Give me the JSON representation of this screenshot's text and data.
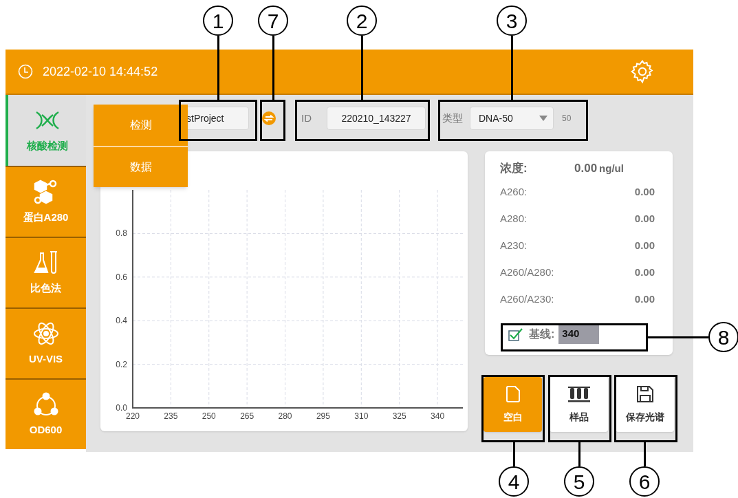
{
  "header": {
    "datetime": "2022-02-10 14:44:52"
  },
  "sidebar": {
    "items": [
      {
        "label": "核酸检测",
        "selected": true
      },
      {
        "label": "蛋白A280",
        "selected": false
      },
      {
        "label": "比色法",
        "selected": false
      },
      {
        "label": "UV-VIS",
        "selected": false
      },
      {
        "label": "OD600",
        "selected": false
      }
    ]
  },
  "popup_menu": {
    "items": [
      "检测",
      "数据"
    ]
  },
  "toolbar": {
    "project": "stProject",
    "id_label": "ID",
    "id_value": "220210_143227",
    "type_label": "类型",
    "type_value": "DNA-50",
    "type_extra": "50"
  },
  "chart": {
    "chart_data": {
      "type": "line",
      "grid": true,
      "xlim": [
        220,
        350
      ],
      "ylim": [
        0,
        1
      ],
      "xticks": [
        220,
        235,
        250,
        265,
        280,
        295,
        310,
        325,
        340
      ],
      "yticks": [
        {
          "value": 0,
          "label": "0.0"
        },
        {
          "value": 0.2,
          "label": "0.2"
        },
        {
          "value": 0.4,
          "label": "0.4"
        },
        {
          "value": 0.6,
          "label": "0.6"
        },
        {
          "value": 0.8,
          "label": "0.8"
        }
      ]
    }
  },
  "results": {
    "concentration": {
      "label": "浓度:",
      "value": "0.00",
      "unit": "ng/ul"
    },
    "rows": [
      {
        "label": "A260:",
        "value": "0.00"
      },
      {
        "label": "A280:",
        "value": "0.00"
      },
      {
        "label": "A230:",
        "value": "0.00"
      },
      {
        "label": "A260/A280:",
        "value": "0.00"
      },
      {
        "label": "A260/A230:",
        "value": "0.00"
      }
    ],
    "baseline": {
      "checked": true,
      "label": "基线:",
      "value": "340"
    }
  },
  "actions": [
    {
      "label": "空白",
      "selected": true
    },
    {
      "label": "样品",
      "selected": false
    },
    {
      "label": "保存光谱",
      "selected": false
    }
  ],
  "callouts": [
    "1",
    "7",
    "2",
    "3",
    "8",
    "4",
    "5",
    "6"
  ]
}
